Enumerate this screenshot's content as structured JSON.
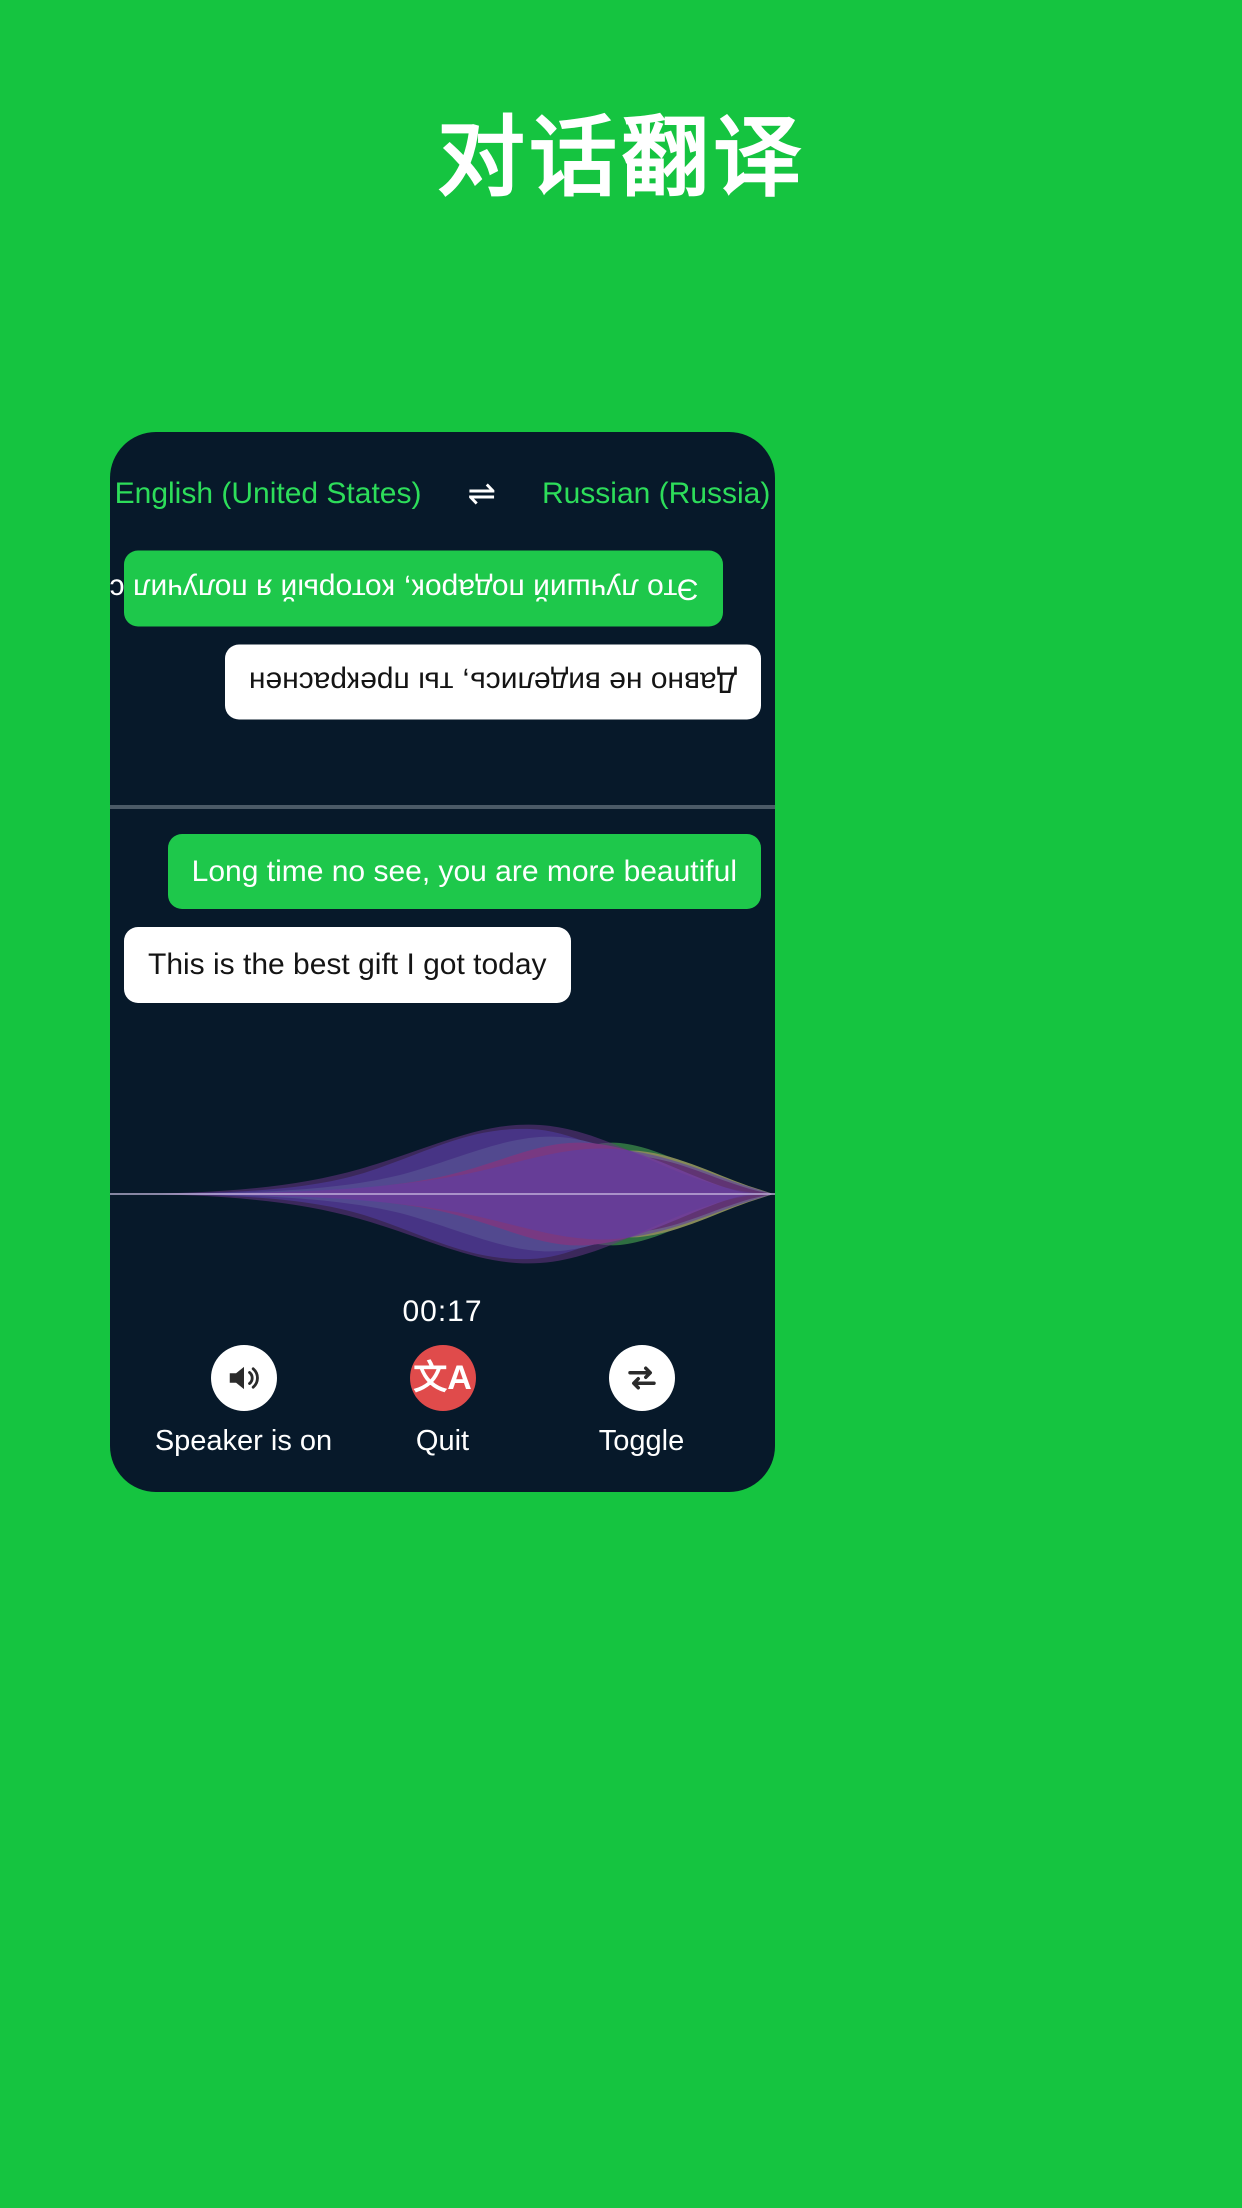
{
  "page": {
    "title": "对话翻译",
    "background_color": "#15c440"
  },
  "device": {
    "background_color": "#07192a",
    "language_bar": {
      "source_language": "English (United States)",
      "swap_icon": "swap-horizontal-icon",
      "swap_glyph": "⇌",
      "target_language": "Russian (Russia)",
      "text_color": "#2ddd5a"
    },
    "top_pane": {
      "rotated": "180",
      "messages": [
        {
          "text": "Это лучший подарок, который я получил сегодня",
          "style": "green",
          "align": "right"
        },
        {
          "text": "Давно не виделись, ты прекраснен",
          "style": "white",
          "align": "left"
        }
      ]
    },
    "bottom_pane": {
      "messages": [
        {
          "text": "Long time no see, you are more beautiful",
          "style": "green",
          "align": "right"
        },
        {
          "text": "This is the best gift I got today",
          "style": "white",
          "align": "left"
        }
      ]
    },
    "waveform": {
      "label": "audio-waveform",
      "colors": [
        "#2b3fa8",
        "#4f7ec8",
        "#3f8f4a",
        "#b4b56a",
        "#8e2a2a",
        "#c14fa0",
        "#7b4fd6",
        "#8c3fa8"
      ]
    },
    "timer": "00:17",
    "controls": [
      {
        "label": "Speaker is on",
        "icon": "speaker-on-icon",
        "circle_color": "#ffffff",
        "icon_color": "#2b2b2b"
      },
      {
        "label": "Quit",
        "icon": "translate-icon",
        "circle_color": "#e04b4b",
        "icon_color": "#ffffff",
        "glyph": "文A"
      },
      {
        "label": "Toggle",
        "icon": "repeat-swap-icon",
        "circle_color": "#ffffff",
        "icon_color": "#2b2b2b"
      }
    ]
  }
}
